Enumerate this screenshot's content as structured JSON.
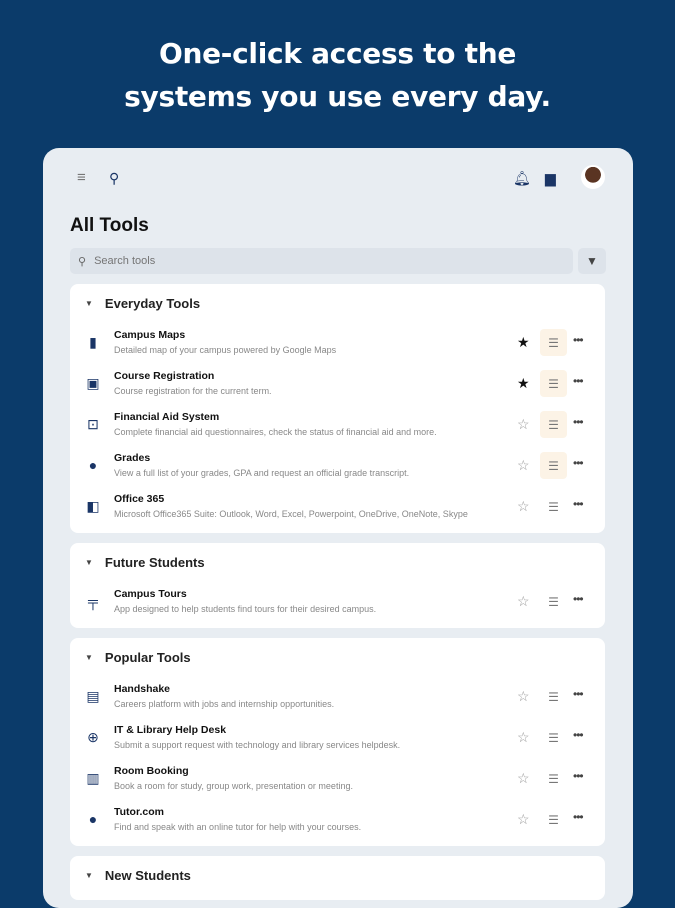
{
  "headline": {
    "line1": "One-click access to the",
    "line2": "systems you use every day."
  },
  "header": {
    "title": "All Tools",
    "search_placeholder": "Search tools"
  },
  "sections": [
    {
      "title": "Everyday Tools",
      "items": [
        {
          "name": "Campus Maps",
          "desc": "Detailed map of your campus powered by Google Maps",
          "icon": "map-icon",
          "favorite": true,
          "highlight": true
        },
        {
          "name": "Course Registration",
          "desc": "Course registration for the current term.",
          "icon": "monitor-icon",
          "favorite": true,
          "highlight": true
        },
        {
          "name": "Financial Aid System",
          "desc": "Complete financial aid questionnaires, check the status of financial aid and more.",
          "icon": "money-icon",
          "favorite": false,
          "highlight": true
        },
        {
          "name": "Grades",
          "desc": "View a full list of your grades, GPA and request an official grade transcript.",
          "icon": "verified-icon",
          "favorite": false,
          "highlight": true
        },
        {
          "name": "Office 365",
          "desc": "Microsoft Office365 Suite: Outlook, Word, Excel, Powerpoint, OneDrive, OneNote, Skype",
          "icon": "office-icon",
          "favorite": false,
          "highlight": false
        }
      ]
    },
    {
      "title": "Future Students",
      "items": [
        {
          "name": "Campus Tours",
          "desc": "App designed to help students find tours for their desired campus.",
          "icon": "signpost-icon",
          "favorite": false,
          "highlight": false
        }
      ]
    },
    {
      "title": "Popular Tools",
      "items": [
        {
          "name": "Handshake",
          "desc": "Careers platform with jobs and internship opportunities.",
          "icon": "job-search-icon",
          "favorite": false,
          "highlight": false
        },
        {
          "name": "IT & Library Help Desk",
          "desc": "Submit a support request with technology and library services helpdesk.",
          "icon": "lifebuoy-icon",
          "favorite": false,
          "highlight": false
        },
        {
          "name": "Room Booking",
          "desc": "Book a room for study, group work, presentation or meeting.",
          "icon": "building-icon",
          "favorite": false,
          "highlight": false
        },
        {
          "name": "Tutor.com",
          "desc": "Find and speak with an online tutor for help with your courses.",
          "icon": "tutor-icon",
          "favorite": false,
          "highlight": false
        }
      ]
    },
    {
      "title": "New Students",
      "items": []
    }
  ]
}
